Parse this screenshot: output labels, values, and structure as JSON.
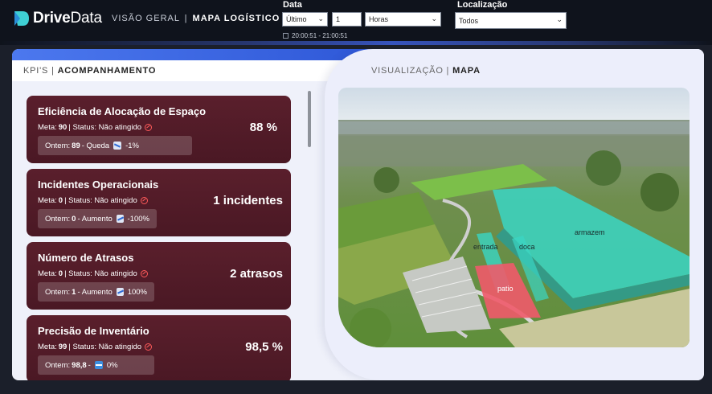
{
  "app": {
    "logo": "DriveData"
  },
  "heading": {
    "section": "VISÃO GERAL",
    "separator": "|",
    "page": "MAPA LOGÍSTICO"
  },
  "filters": {
    "data_label": "Data",
    "period_value": "Último",
    "amount_value": "1",
    "unit_value": "Horas",
    "time_range": "20:00:51 - 21:00:51",
    "location_label": "Localização",
    "location_value": "Todos"
  },
  "left_panel": {
    "title_prefix": "KPI'S",
    "separator": "|",
    "title": "ACOMPANHAMENTO"
  },
  "right_panel": {
    "title_prefix": "VISUALIZAÇÃO",
    "separator": "|",
    "title": "MAPA"
  },
  "kpis": [
    {
      "title": "Eficiência de Alocação de Espaço",
      "meta_label": "Meta:",
      "meta_value": "90",
      "status_label": "| Status:",
      "status": "Não atingido",
      "ontem_label": "Ontem:",
      "ontem_value": "89",
      "trend_label": "- Queda",
      "change": "-1%",
      "value": "88 %"
    },
    {
      "title": "Incidentes Operacionais",
      "meta_label": "Meta:",
      "meta_value": "0",
      "status_label": "| Status:",
      "status": "Não atingido",
      "ontem_label": "Ontem:",
      "ontem_value": "0",
      "trend_label": "- Aumento",
      "change": "-100%",
      "value": "1 incidentes"
    },
    {
      "title": "Número de Atrasos",
      "meta_label": "Meta:",
      "meta_value": "0",
      "status_label": "| Status:",
      "status": "Não atingido",
      "ontem_label": "Ontem:",
      "ontem_value": "1",
      "trend_label": "- Aumento",
      "change": "100%",
      "value": "2 atrasos"
    },
    {
      "title": "Precisão de Inventário",
      "meta_label": "Meta:",
      "meta_value": "99",
      "status_label": "| Status:",
      "status": "Não atingido",
      "ontem_label": "Ontem:",
      "ontem_value": "98,8",
      "trend_label": "-",
      "change": "0%",
      "value": "98,5 %"
    }
  ],
  "map": {
    "zones": [
      {
        "name": "armazem",
        "color": "#3ad6c4"
      },
      {
        "name": "entrada",
        "color": "#3ad6c4"
      },
      {
        "name": "doca",
        "color": "#3ad6c4"
      },
      {
        "name": "patio",
        "color": "#f05a6a"
      }
    ]
  },
  "icons": {
    "status": "ban-icon",
    "trend_down": "trend-down-icon",
    "trend_up": "trend-up-icon",
    "trend_flat": "trend-flat-icon",
    "dropdown": "chevron-down-icon",
    "calendar": "calendar-icon"
  }
}
